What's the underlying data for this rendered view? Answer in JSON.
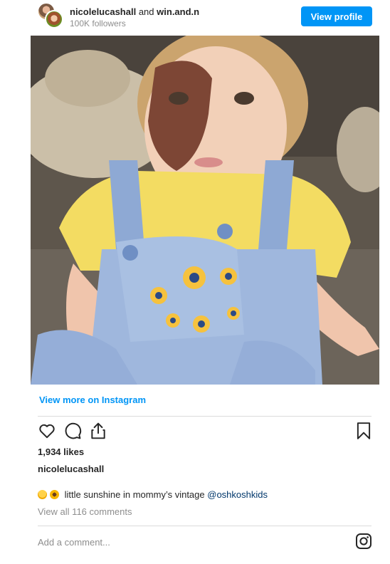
{
  "header": {
    "username": "nicolelucashall",
    "and_text": "and",
    "collaborator": "win.and.n",
    "followers": "100K followers",
    "view_profile": "View profile"
  },
  "post": {
    "view_more": "View more on Instagram",
    "likes": "1,934 likes",
    "username": "nicolelucashall",
    "caption_text": " little sunshine in mommy’s vintage ",
    "caption_mention": "@oshkoshkids",
    "view_comments": "View all 116 comments",
    "add_comment_placeholder": "Add a comment..."
  },
  "icons": {
    "like": "heart-icon",
    "comment": "comment-icon",
    "share": "share-icon",
    "save": "bookmark-icon",
    "instagram": "instagram-icon"
  },
  "colors": {
    "accent": "#0095f6",
    "mention": "#00376b",
    "muted": "#8e8e8e"
  }
}
